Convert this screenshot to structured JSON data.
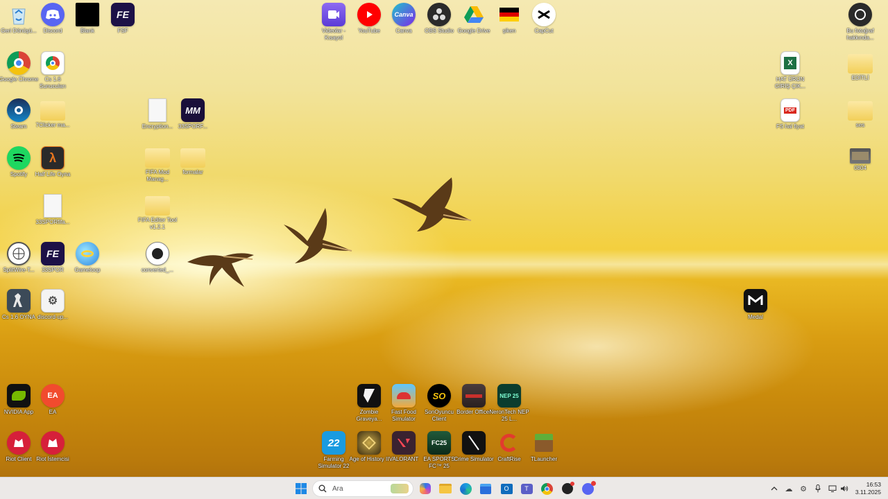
{
  "desktop": {
    "icons": [
      {
        "label": "Geri Dönüşü...",
        "icon": "recycle-bin-icon"
      },
      {
        "label": "Discord",
        "icon": "discord-icon"
      },
      {
        "label": "Blank",
        "icon": "blank-icon"
      },
      {
        "label": "FSF",
        "icon": "fe-icon"
      },
      {
        "label": "Google Chrome",
        "icon": "chrome-icon"
      },
      {
        "label": "Cs 1.6 Sunucuları",
        "icon": "chrome-shortcut-icon"
      },
      {
        "label": "Steam",
        "icon": "steam-icon"
      },
      {
        "label": "7Clicker ma...",
        "icon": "folder-icon"
      },
      {
        "label": "Encryption...",
        "icon": "file-icon"
      },
      {
        "label": "33SPORF...",
        "icon": "mm-icon"
      },
      {
        "label": "Spotify",
        "icon": "spotify-icon"
      },
      {
        "label": "Half Life Oyna",
        "icon": "half-life-icon"
      },
      {
        "label": "FIFA Mod Manag...",
        "icon": "folder-icon"
      },
      {
        "label": "formalar",
        "icon": "folder-icon"
      },
      {
        "label": "33SPORfifa...",
        "icon": "file-icon"
      },
      {
        "label": "FIFA Editor Tool v1.2.1",
        "icon": "folder-icon"
      },
      {
        "label": "SplitWire-T...",
        "icon": "splitwire-icon"
      },
      {
        "label": "33SPOR",
        "icon": "fe-icon"
      },
      {
        "label": "Gameloop",
        "icon": "gameloop-icon"
      },
      {
        "label": "converted_...",
        "icon": "converted-icon"
      },
      {
        "label": "Cs 1.6 OYNA",
        "icon": "counter-strike-icon"
      },
      {
        "label": "discord-up...",
        "icon": "settings-file-icon"
      },
      {
        "label": "NVIDIA App",
        "icon": "nvidia-icon"
      },
      {
        "label": "EA",
        "icon": "ea-icon"
      },
      {
        "label": "Riot Client",
        "icon": "riot-icon"
      },
      {
        "label": "Riot İstemcisi",
        "icon": "riot-icon"
      },
      {
        "label": "Videolar - Kısayol",
        "icon": "videos-icon"
      },
      {
        "label": "YouTube",
        "icon": "youtube-icon"
      },
      {
        "label": "Canva",
        "icon": "canva-icon"
      },
      {
        "label": "OBS Studio",
        "icon": "obs-icon"
      },
      {
        "label": "Google Drive",
        "icon": "google-drive-icon"
      },
      {
        "label": "şiken",
        "icon": "flag-icon"
      },
      {
        "label": "CapCut",
        "icon": "capcut-icon"
      },
      {
        "label": "Zombie Graveya...",
        "icon": "zombie-icon"
      },
      {
        "label": "Fast Food Simulator",
        "icon": "fastfood-icon"
      },
      {
        "label": "SonOyuncu Client",
        "icon": "sonoyuncu-icon"
      },
      {
        "label": "Border Officer",
        "icon": "border-officer-icon"
      },
      {
        "label": "NeronTech NEP 25 L...",
        "icon": "nep-icon"
      },
      {
        "label": "Farming Simulator 22",
        "icon": "farming-icon"
      },
      {
        "label": "Age of History II",
        "icon": "age-of-history-icon"
      },
      {
        "label": "VALORANT",
        "icon": "valorant-icon"
      },
      {
        "label": "EA SPORTS FC™ 25",
        "icon": "fc25-icon"
      },
      {
        "label": "Crime Simulator",
        "icon": "crime-icon"
      },
      {
        "label": "CraftRise",
        "icon": "craftrise-icon"
      },
      {
        "label": "TLauncher",
        "icon": "tlauncher-icon"
      },
      {
        "label": "Bu fotoğraf hakkında...",
        "icon": "camera-icon"
      },
      {
        "label": "HAT ÜRÜN GİRİŞ ÇIK...",
        "icon": "excel-icon"
      },
      {
        "label": "EDİTLİ",
        "icon": "folder-icon"
      },
      {
        "label": "FS hal fiyat",
        "icon": "pdf-icon"
      },
      {
        "label": "ses",
        "icon": "folder-icon"
      },
      {
        "label": "0804",
        "icon": "video-thumb-icon"
      },
      {
        "label": "Medal",
        "icon": "medal-icon"
      }
    ]
  },
  "taskbar": {
    "search_placeholder": "Ara",
    "clock_time": "16:53",
    "clock_date": "3.11.2025"
  }
}
